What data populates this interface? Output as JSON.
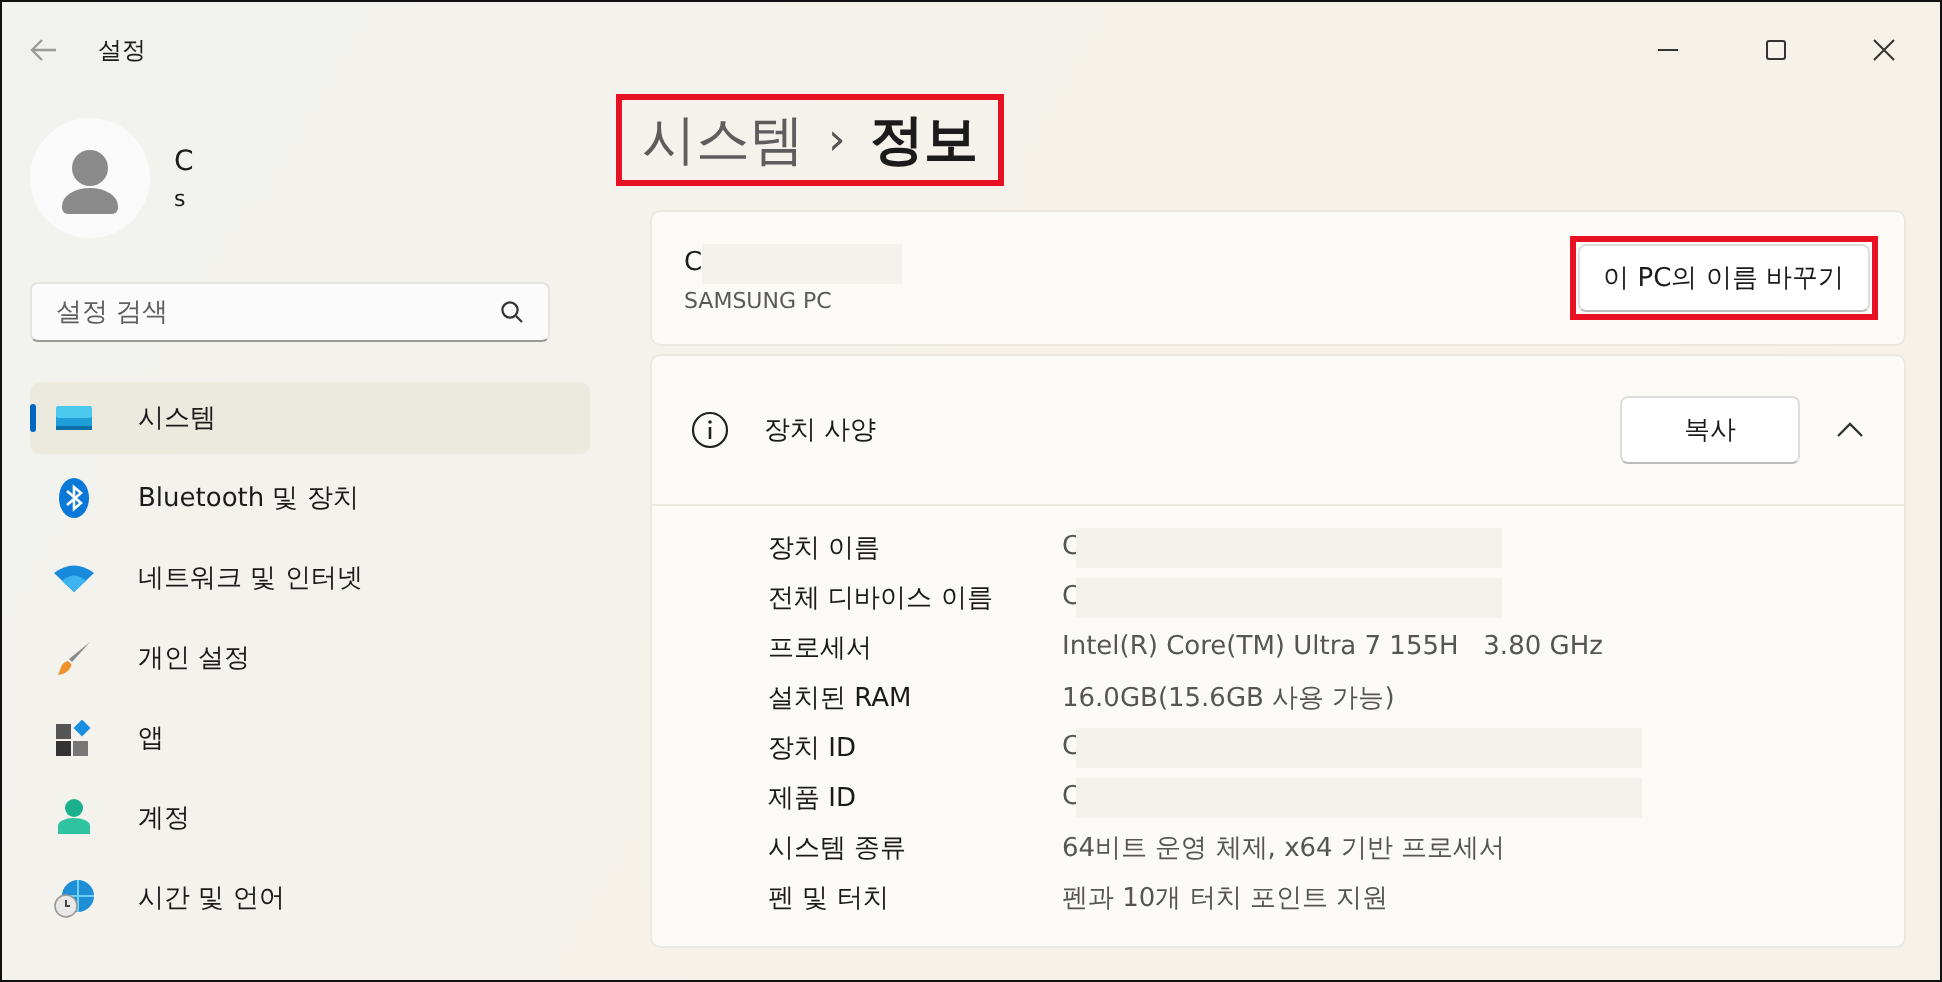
{
  "window": {
    "title": "설정"
  },
  "user": {
    "name": "C",
    "email": "s"
  },
  "search": {
    "placeholder": "설정 검색"
  },
  "sidebar": {
    "items": [
      {
        "label": "시스템",
        "selected": true
      },
      {
        "label": "Bluetooth 및 장치",
        "selected": false
      },
      {
        "label": "네트워크 및 인터넷",
        "selected": false
      },
      {
        "label": "개인 설정",
        "selected": false
      },
      {
        "label": "앱",
        "selected": false
      },
      {
        "label": "계정",
        "selected": false
      },
      {
        "label": "시간 및 언어",
        "selected": false
      }
    ]
  },
  "breadcrumb": {
    "parent": "시스템",
    "separator": "›",
    "current": "정보",
    "highlighted": true
  },
  "device_card": {
    "name": "C",
    "model": "SAMSUNG PC",
    "rename_button": {
      "label": "이 PC의 이름 바꾸기",
      "highlighted": true
    }
  },
  "specs": {
    "title": "장치 사양",
    "copy_button": "복사",
    "expanded": true,
    "rows": [
      {
        "label": "장치 이름",
        "value": "C",
        "redacted": true
      },
      {
        "label": "전체 디바이스 이름",
        "value": "C",
        "redacted": true
      },
      {
        "label": "프로세서",
        "value": "Intel(R) Core(TM) Ultra 7 155H   3.80 GHz",
        "redacted": false
      },
      {
        "label": "설치된 RAM",
        "value": "16.0GB(15.6GB 사용 가능)",
        "redacted": false
      },
      {
        "label": "장치 ID",
        "value": "C",
        "redacted": true
      },
      {
        "label": "제품 ID",
        "value": "C",
        "redacted": true
      },
      {
        "label": "시스템 종류",
        "value": "64비트 운영 체제, x64 기반 프로세서",
        "redacted": false
      },
      {
        "label": "펜 및 터치",
        "value": "펜과 10개 터치 포인트 지원",
        "redacted": false
      }
    ]
  }
}
